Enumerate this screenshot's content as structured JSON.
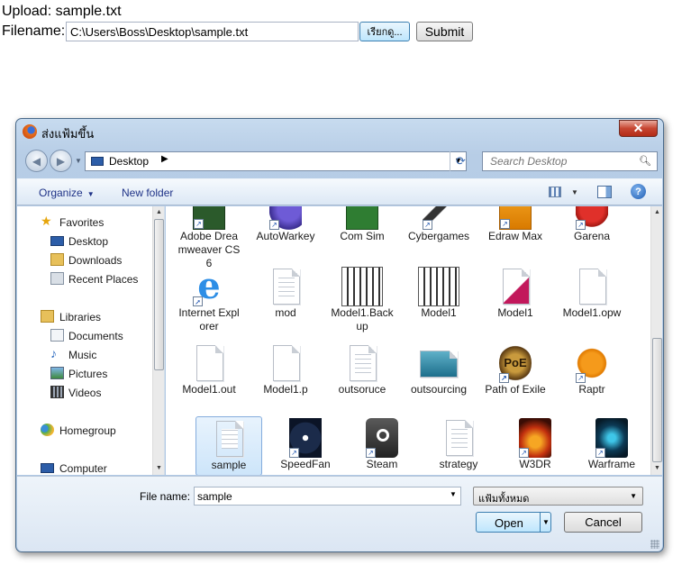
{
  "page": {
    "upload_heading": "Upload: sample.txt",
    "filename_label": "Filename:",
    "path_value": "C:\\Users\\Boss\\Desktop\\sample.txt",
    "browse_label": "เรียกดู...",
    "submit_label": "Submit"
  },
  "dialog": {
    "title": "ส่งแฟ้มขึ้น",
    "address": "Desktop",
    "search_placeholder": "Search Desktop",
    "toolbar": {
      "organize": "Organize",
      "new_folder": "New folder"
    },
    "nav": {
      "favorites": "Favorites",
      "desktop": "Desktop",
      "downloads": "Downloads",
      "recent": "Recent Places",
      "libraries": "Libraries",
      "documents": "Documents",
      "music": "Music",
      "pictures": "Pictures",
      "videos": "Videos",
      "homegroup": "Homegroup",
      "computer": "Computer"
    },
    "files": [
      {
        "label": "Adobe Dreamweaver CS6",
        "icon": "dreamweaver-icon"
      },
      {
        "label": "AutoWarkey",
        "icon": "autowarkey-icon"
      },
      {
        "label": "Com Sim",
        "icon": "comsim-icon"
      },
      {
        "label": "Cybergames",
        "icon": "cybergames-icon"
      },
      {
        "label": "Edraw Max",
        "icon": "edraw-icon"
      },
      {
        "label": "Garena",
        "icon": "garena-icon"
      },
      {
        "label": "Internet Explorer",
        "icon": "internet-explorer-icon"
      },
      {
        "label": "mod",
        "icon": "text-file-icon"
      },
      {
        "label": "Model1.Backup",
        "icon": "model-diagram-icon"
      },
      {
        "label": "Model1",
        "icon": "model-diagram-icon"
      },
      {
        "label": "Model1",
        "icon": "access-db-icon"
      },
      {
        "label": "Model1.opw",
        "icon": "blank-file-icon"
      },
      {
        "label": "Model1.out",
        "icon": "blank-file-icon"
      },
      {
        "label": "Model1.p",
        "icon": "blank-file-icon"
      },
      {
        "label": "outsoruce",
        "icon": "text-file-icon"
      },
      {
        "label": "outsourcing",
        "icon": "image-file-icon"
      },
      {
        "label": "Path of Exile",
        "icon": "path-of-exile-icon"
      },
      {
        "label": "Raptr",
        "icon": "raptr-icon"
      },
      {
        "label": "sample",
        "icon": "text-file-icon"
      },
      {
        "label": "SpeedFan",
        "icon": "speedfan-icon"
      },
      {
        "label": "Steam",
        "icon": "steam-icon"
      },
      {
        "label": "strategy",
        "icon": "text-file-icon"
      },
      {
        "label": "W3DR",
        "icon": "w3dr-icon"
      },
      {
        "label": "Warframe",
        "icon": "warframe-icon"
      }
    ],
    "filename_label": "File name:",
    "filename_value": "sample",
    "filetype": "แฟ้มทั้งหมด",
    "open_label": "Open",
    "cancel_label": "Cancel"
  },
  "colors": {
    "titlebar": "#b7cde6",
    "accent_button": "#bee6fd",
    "close_button": "#c74632"
  }
}
